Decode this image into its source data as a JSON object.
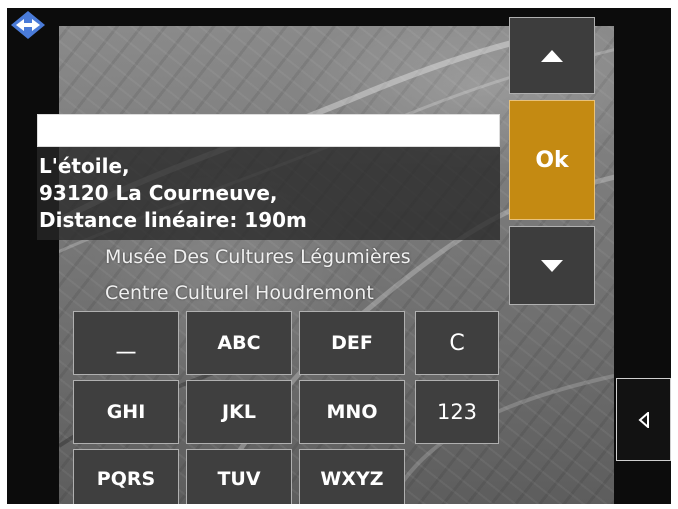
{
  "search": {
    "value": ""
  },
  "result": {
    "line1": "L'étoile,",
    "line2": "93120 La Courneuve,",
    "line3": "Distance linéaire: 190m"
  },
  "suggestions": [
    "Musée Des Cultures Légumières",
    "Centre Culturel Houdremont"
  ],
  "keypad": {
    "row1": [
      "__",
      "ABC",
      "DEF",
      "C"
    ],
    "row2": [
      "GHI",
      "JKL",
      "MNO",
      "123"
    ],
    "row3": [
      "PQRS",
      "TUV",
      "WXYZ"
    ]
  },
  "buttons": {
    "ok": "Ok",
    "scroll_up_icon": "triangle-up-icon",
    "scroll_down_icon": "triangle-down-icon",
    "back_icon": "triangle-left-icon"
  },
  "icons": {
    "logo": "diamond-arrows-icon"
  },
  "colors": {
    "ok_button": "#c48a12",
    "key_background": "#3f3f3f",
    "logo": "#4a7bd8"
  }
}
